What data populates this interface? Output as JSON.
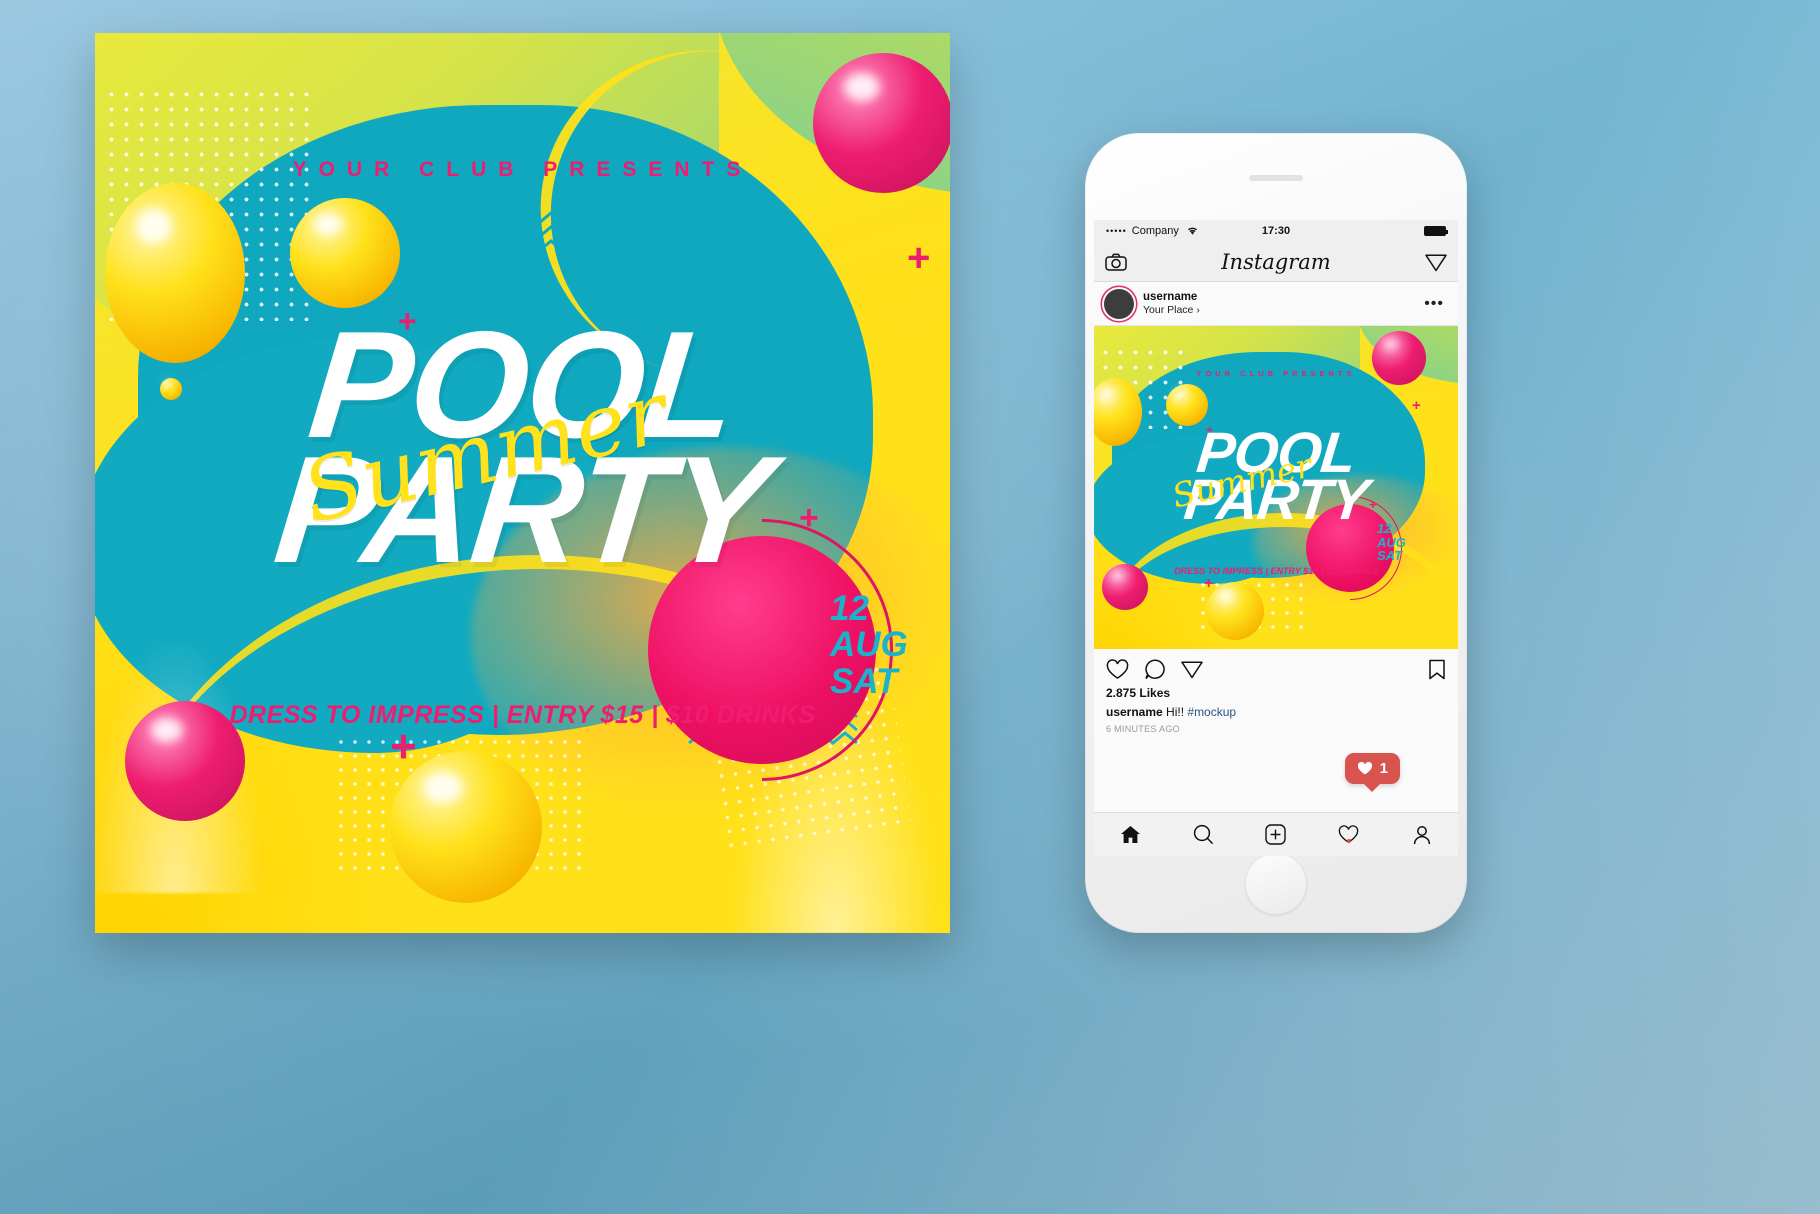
{
  "flyer": {
    "presents": "YOUR CLUB PRESENTS",
    "title_line1": "POOL",
    "title_line2": "PARTY",
    "script_word": "Summer",
    "info": "DRESS TO IMPRESS | ENTRY $15 | $10 DRINKS",
    "date_day": "12",
    "date_month": "AUG",
    "date_weekday": "SAT",
    "colors": {
      "pink": "#ee1d6f",
      "teal": "#0fa8bf",
      "yellow": "#ffe11a",
      "cyan_text": "#19b3cc"
    }
  },
  "phone": {
    "status": {
      "signal_dots": "•••••",
      "carrier": "Company",
      "wifi_icon": "wifi-icon",
      "time": "17:30",
      "battery_icon": "battery-icon"
    },
    "header": {
      "camera_icon": "camera-icon",
      "logo": "Instagram",
      "direct_icon": "paper-plane-icon"
    },
    "post_user": {
      "avatar": "avatar",
      "username": "username",
      "place": "Your Place",
      "place_chevron": "›",
      "more_icon": "•••"
    },
    "actions": {
      "like_icon": "heart-icon",
      "comment_icon": "comment-icon",
      "share_icon": "paper-plane-icon",
      "save_icon": "bookmark-icon"
    },
    "post_meta": {
      "likes": "2.875 Likes",
      "caption_user": "username",
      "caption_text": "Hi!!",
      "caption_tag": "#mockup",
      "timestamp": "6 MINUTES AGO"
    },
    "notification": {
      "icon": "heart-filled-icon",
      "count": "1",
      "color": "#d9534f"
    },
    "tabbar": {
      "home_icon": "home-icon",
      "search_icon": "search-icon",
      "add_icon": "plus-square-icon",
      "activity_icon": "heart-icon",
      "profile_icon": "person-icon"
    }
  }
}
